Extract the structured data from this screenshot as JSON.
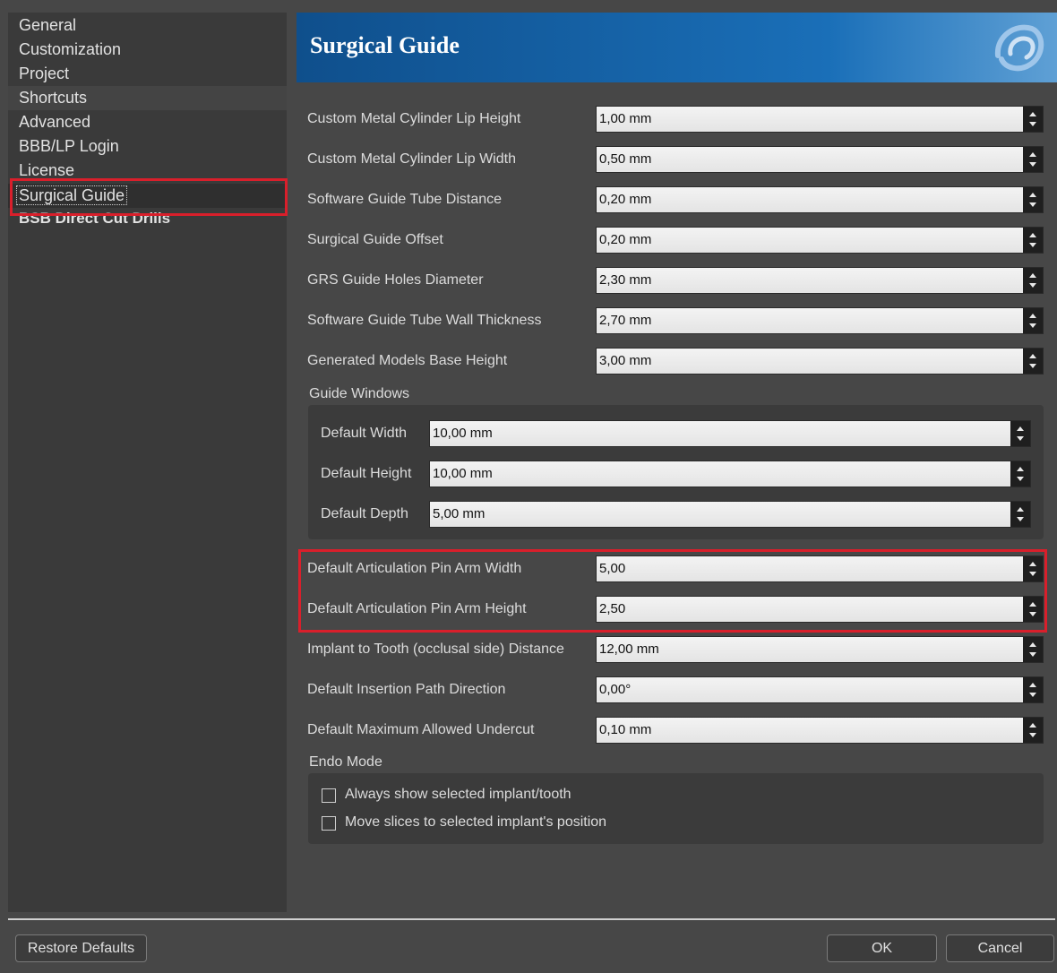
{
  "sidebar": {
    "items": [
      {
        "label": "General"
      },
      {
        "label": "Customization"
      },
      {
        "label": "Project"
      },
      {
        "label": "Shortcuts"
      },
      {
        "label": "Advanced"
      },
      {
        "label": "BBB/LP Login"
      },
      {
        "label": "License"
      },
      {
        "label": "Surgical Guide"
      },
      {
        "label": "BSB Direct Cut Drills"
      }
    ],
    "selected": "Surgical Guide"
  },
  "header": {
    "title": "Surgical Guide",
    "logo": "swirl-logo-icon"
  },
  "fields": [
    {
      "label": "Custom Metal Cylinder Lip Height",
      "value": "1,00 mm"
    },
    {
      "label": "Custom Metal Cylinder Lip Width",
      "value": "0,50 mm"
    },
    {
      "label": "Software Guide Tube Distance",
      "value": "0,20 mm"
    },
    {
      "label": "Surgical Guide Offset",
      "value": "0,20 mm"
    },
    {
      "label": "GRS Guide Holes Diameter",
      "value": "2,30 mm"
    },
    {
      "label": "Software Guide Tube Wall Thickness",
      "value": "2,70 mm"
    },
    {
      "label": "Generated Models Base Height",
      "value": "3,00 mm"
    }
  ],
  "guide_windows": {
    "title": "Guide Windows",
    "fields": [
      {
        "label": "Default Width",
        "value": "10,00 mm"
      },
      {
        "label": "Default Height",
        "value": "10,00 mm"
      },
      {
        "label": "Default Depth",
        "value": "5,00 mm"
      }
    ]
  },
  "pin_fields": [
    {
      "label": "Default Articulation Pin Arm Width",
      "value": "5,00"
    },
    {
      "label": "Default Articulation Pin Arm Height",
      "value": "2,50"
    }
  ],
  "more_fields": [
    {
      "label": "Implant to Tooth (occlusal side) Distance",
      "value": "12,00 mm"
    },
    {
      "label": "Default Insertion Path Direction",
      "value": "0,00°"
    },
    {
      "label": "Default Maximum Allowed Undercut",
      "value": "0,10 mm"
    }
  ],
  "endo_mode": {
    "title": "Endo Mode",
    "options": [
      {
        "label": "Always show selected implant/tooth",
        "checked": false
      },
      {
        "label": "Move slices to selected implant's position",
        "checked": false
      }
    ]
  },
  "footer": {
    "restore_label": "Restore Defaults",
    "ok_label": "OK",
    "cancel_label": "Cancel"
  },
  "colors": {
    "highlight": "#d91f2b",
    "header_blue": "#1a6fb8"
  }
}
